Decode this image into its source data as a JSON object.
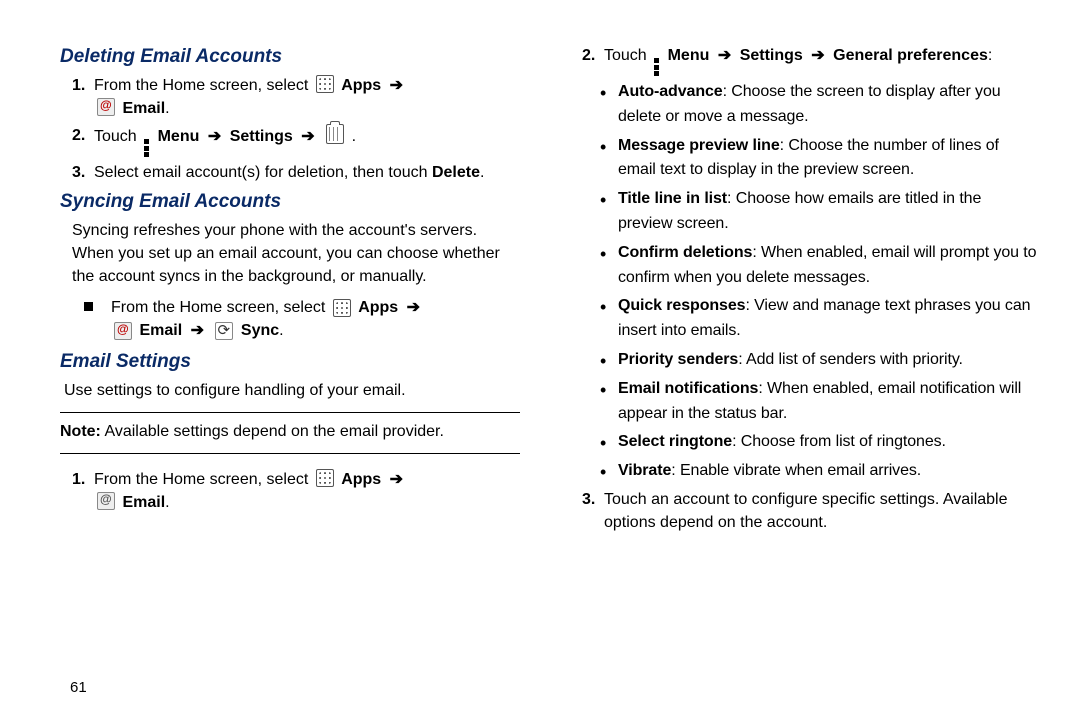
{
  "pageNumber": "61",
  "left": {
    "h1": "Deleting Email Accounts",
    "steps1": [
      {
        "num": "1.",
        "pre": "From the Home screen, select ",
        "apps": "Apps",
        "post": "",
        "line2": "Email",
        "endDot": "."
      },
      {
        "num": "2.",
        "pre": "Touch ",
        "menu": "Menu",
        "settings": "Settings",
        "endDot": "."
      },
      {
        "num": "3.",
        "text": "Select email account(s) for deletion, then touch ",
        "delete": "Delete",
        "endDot": "."
      }
    ],
    "h2": "Syncing Email Accounts",
    "syncPara": "Syncing refreshes your phone with the account's servers. When you set up an email account, you can choose whether the account syncs in the background, or manually.",
    "syncStep": {
      "pre": "From the Home screen, select ",
      "apps": "Apps",
      "email": "Email",
      "sync": "Sync",
      "endDot": "."
    },
    "h3": "Email Settings",
    "settingsPara": "Use settings to configure handling of your email.",
    "noteLabel": "Note:",
    "noteText": " Available settings depend on the email provider.",
    "steps2": [
      {
        "num": "1.",
        "pre": "From the Home screen, select ",
        "apps": "Apps",
        "email": "Email",
        "endDot": "."
      }
    ]
  },
  "right": {
    "step2": {
      "num": "2.",
      "pre": "Touch ",
      "menu": "Menu",
      "settings": "Settings",
      "general": "General preferences",
      "colon": ":"
    },
    "bullets": [
      {
        "b": "Auto-advance",
        "t": ": Choose the screen to display after you delete or move a message."
      },
      {
        "b": "Message preview line",
        "t": ": Choose the number of lines of email text to display in the preview screen."
      },
      {
        "b": "Title line in list",
        "t": ": Choose how emails are titled in the preview screen."
      },
      {
        "b": "Confirm deletions",
        "t": ": When enabled, email will prompt you to confirm when you delete messages."
      },
      {
        "b": "Quick responses",
        "t": ": View and manage text phrases you can insert into emails."
      },
      {
        "b": "Priority senders",
        "t": ": Add list of senders with priority."
      },
      {
        "b": "Email notifications",
        "t": ": When enabled, email notification will appear in the status bar."
      },
      {
        "b": "Select ringtone",
        "t": ": Choose from list of ringtones."
      },
      {
        "b": "Vibrate",
        "t": ": Enable vibrate when email arrives."
      }
    ],
    "step3": {
      "num": "3.",
      "text": "Touch an account to configure specific settings. Available options depend on the account."
    }
  }
}
